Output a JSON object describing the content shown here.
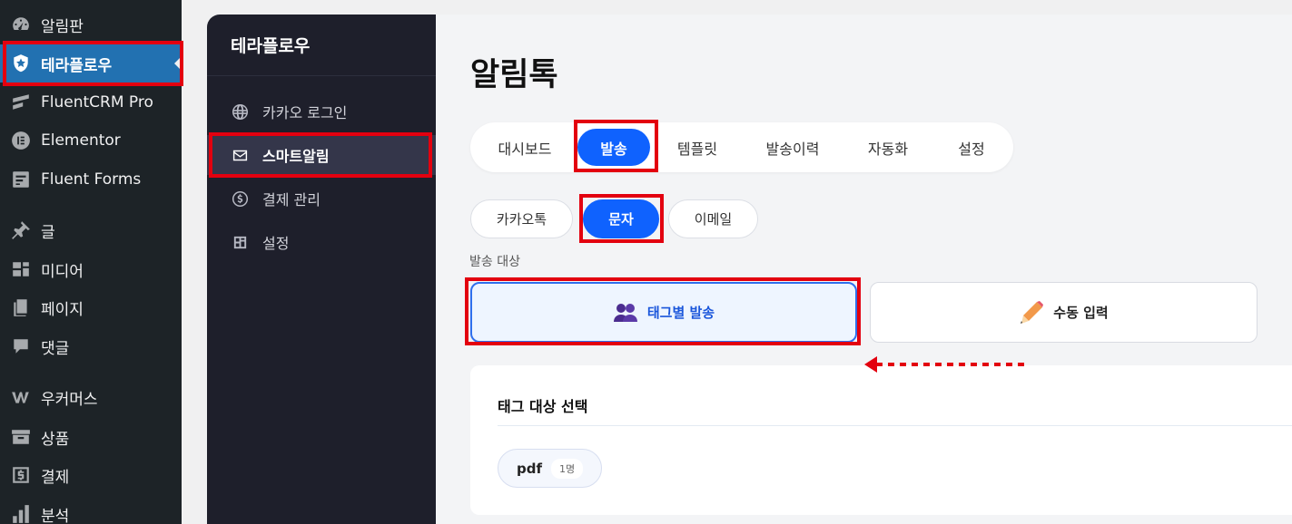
{
  "wp_sidebar": {
    "items": [
      {
        "label": "알림판",
        "icon": "dashboard-icon"
      },
      {
        "label": "테라플로우",
        "icon": "shield-icon"
      },
      {
        "label": "FluentCRM Pro",
        "icon": "fluentcrm-icon"
      },
      {
        "label": "Elementor",
        "icon": "elementor-icon"
      },
      {
        "label": "Fluent Forms",
        "icon": "fluent-forms-icon"
      },
      {
        "label": "글",
        "icon": "pin-icon"
      },
      {
        "label": "미디어",
        "icon": "media-icon"
      },
      {
        "label": "페이지",
        "icon": "page-icon"
      },
      {
        "label": "댓글",
        "icon": "comment-icon"
      },
      {
        "label": "우커머스",
        "icon": "woocommerce-icon"
      },
      {
        "label": "상품",
        "icon": "archive-icon"
      },
      {
        "label": "결제",
        "icon": "payment-icon"
      },
      {
        "label": "분석",
        "icon": "chart-icon"
      }
    ]
  },
  "plugin_sidebar": {
    "brand": "테라플로우",
    "items": [
      {
        "label": "카카오 로그인",
        "icon": "globe-icon"
      },
      {
        "label": "스마트알림",
        "icon": "envelope-icon"
      },
      {
        "label": "결제 관리",
        "icon": "dollar-icon"
      },
      {
        "label": "설정",
        "icon": "settings-icon"
      }
    ]
  },
  "main": {
    "title": "알림톡",
    "tabs": [
      "대시보드",
      "발송",
      "템플릿",
      "발송이력",
      "자동화",
      "설정"
    ],
    "active_tab": "발송",
    "subtabs": [
      "카카오톡",
      "문자",
      "이메일"
    ],
    "active_subtab": "문자",
    "target_label": "발송 대상",
    "targets": [
      {
        "label": "태그별 발송",
        "icon": "users-icon"
      },
      {
        "label": "수동 입력",
        "icon": "pencil-icon"
      }
    ],
    "active_target": "태그별 발송",
    "card": {
      "title": "태그 대상 선택",
      "tags": [
        {
          "name": "pdf",
          "count": "1명"
        }
      ]
    }
  },
  "colors": {
    "accent": "#0f62fe",
    "highlight": "#e3000f",
    "wp_active": "#2271b1"
  }
}
